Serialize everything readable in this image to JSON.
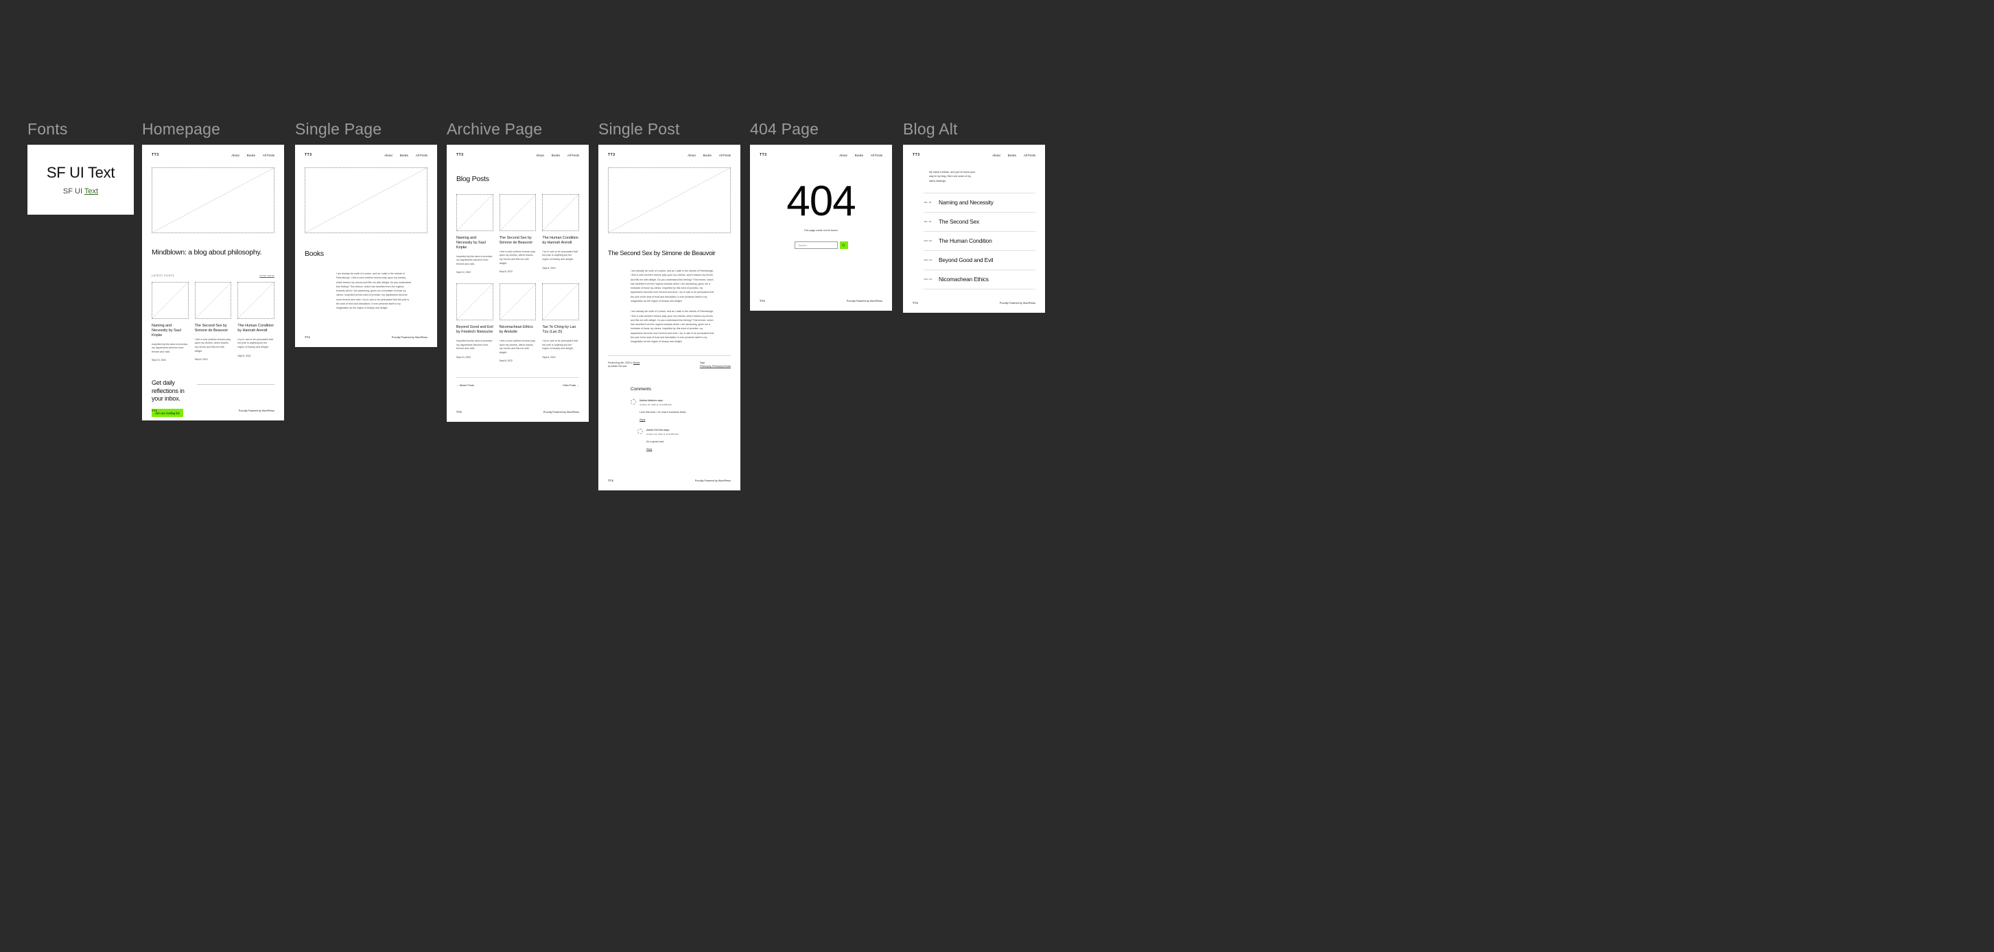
{
  "nav": {
    "items": [
      "About",
      "Books",
      "All Posts"
    ]
  },
  "brand": {
    "logo": "TT3"
  },
  "footer": {
    "left": "TT3",
    "right": "Proudly Powered by WordPress"
  },
  "frames": {
    "fonts": "Fonts",
    "homepage": "Homepage",
    "single_page": "Single Page",
    "archive": "Archive Page",
    "single_post": "Single Post",
    "page_404": "404 Page",
    "blog_alt": "Blog Alt"
  },
  "fonts_panel": {
    "title": "SF UI Text",
    "sub_prefix": "SF UI ",
    "sub_link": "Text",
    "link_color": "#2f6b1f"
  },
  "homepage": {
    "hero_image": "placeholder-image",
    "heading": "Mindblown: a blog about philosophy.",
    "latest_label": "LATEST POSTS",
    "view_more": "View more",
    "cards": [
      {
        "title": "Naming and Necessity by Saul Kripke",
        "excerpt": "Inspirited by this wind of promise, my daydreams become more fervent and vivid.",
        "date": "Sept 10, 2021"
      },
      {
        "title": "The Second Sex by Simone de Beauvoir",
        "excerpt": "I feel a cold northern breeze play upon my cheeks, which braces my nerves and fills me with delight.",
        "date": "Sept 8, 2021"
      },
      {
        "title": "The Human Condition by Hannah Arendt",
        "excerpt": "I try in vain to be persuaded that the pole is anything but the region of beauty and delight.",
        "date": "Sept 8, 2021"
      }
    ],
    "newsletter": {
      "heading": "Get daily reflections in your inbox.",
      "button": "Join our mailing list",
      "button_color": "#7bec0a"
    }
  },
  "single_page": {
    "heading": "Books",
    "paragraph": "I am already far north of London, and as I walk in the streets of Petersburgh, I feel a cold northern breeze play upon my cheeks, which braces my nerves and fills me with delight. Do you understand this feeling? This breeze, which has travelled from the regions towards which I am advancing, gives me a foretaste of those icy climes. Inspirited by this wind of promise, my daydreams become more fervent and vivid. I try in vain to be persuaded that the pole is the seat of frost and desolation; it ever presents itself to my imagination as the region of beauty and delight."
  },
  "archive": {
    "heading": "Blog Posts",
    "cards": [
      {
        "title": "Naming and Necessity by Saul Kripke",
        "excerpt": "Inspirited by this wind of promise, my daydreams become more fervent and vivid.",
        "date": "Sept 10, 2022"
      },
      {
        "title": "The Second Sex by Simone de Beauvoir",
        "excerpt": "I feel a cold northern breeze play upon my cheeks, which braces my nerves and fills me with delight.",
        "date": "Sept 8, 2022"
      },
      {
        "title": "The Human Condition by Hannah Arendt",
        "excerpt": "I try in vain to be persuaded that the pole is anything but the region of beauty and delight.",
        "date": "Sept 8, 2022"
      },
      {
        "title": "Beyond Good and Evil by Friedrich Nietzsche",
        "excerpt": "Inspirited by this wind of promise, my daydreams become more fervent and vivid.",
        "date": "Sept 10, 2022"
      },
      {
        "title": "Nicomachean Ethics by Aristotle",
        "excerpt": "I feel a cold northern breeze play upon my cheeks, which braces my nerves and fills me with delight.",
        "date": "Sept 8, 2022"
      },
      {
        "title": "Tao Te Ching by Lao Tzu (Lao Zi)",
        "excerpt": "I try in vain to be persuaded that the pole is anything but the region of beauty and delight.",
        "date": "Sept 8, 2022"
      }
    ],
    "pagination": {
      "newer": "← Newer Posts",
      "older": "Older Posts →"
    }
  },
  "single_post": {
    "title": "The Second Sex by Simone de Beauvoir",
    "paragraph": "I am already far north of London, and as I walk in the streets of Petersburgh, I feel a cold northern breeze play upon my cheeks, which braces my nerves and fills me with delight. Do you understand this feeling? This breeze, which has travelled from the regions towards which I am advancing, gives me a foretaste of those icy climes. Inspirited by this wind of promise, my daydreams become more fervent and vivid. I try in vain to be persuaded that the pole is the seat of frost and desolation; it ever presents itself to my imagination as the region of beauty and delight.",
    "meta": {
      "posted_prefix": "Posted Aug 4th, 2022 in ",
      "category": "Books",
      "author_line": "by Adrian DeCarlo",
      "tags_label": "Tags:",
      "tags": "Philosophy, Philosophy Books"
    },
    "comments_heading": "Comments",
    "comments": [
      {
        "name": "Martha Mathers says:",
        "time": "October 24, 2022 at 12:11PM  Edit",
        "body": "Love this book. I've read it countless times.",
        "reply": "Reply"
      },
      {
        "name": "Adrian DeCarlo says:",
        "time": "October 24, 2022 at 12:11PM  Edit",
        "body": "It's a great read.",
        "reply": "Reply"
      }
    ]
  },
  "page_404": {
    "code": "404",
    "message": "This page could not be found.",
    "search_placeholder": "Search...",
    "search_icon": "search-icon",
    "search_button_color": "#7bec0a"
  },
  "blog_alt": {
    "intro": "My name's Adrian, and you've found your way to my blog. Here are some of my latest readings.",
    "posts": [
      {
        "date": "JUL 15",
        "title": "Naming and Necessity"
      },
      {
        "date": "JUL 10",
        "title": "The Second Sex"
      },
      {
        "date": "JUN 29",
        "title": "The Human Condition"
      },
      {
        "date": "JUN 19",
        "title": "Beyond Good and Evil"
      },
      {
        "date": "JUN 19",
        "title": "Nicomachean Ethics"
      }
    ]
  }
}
